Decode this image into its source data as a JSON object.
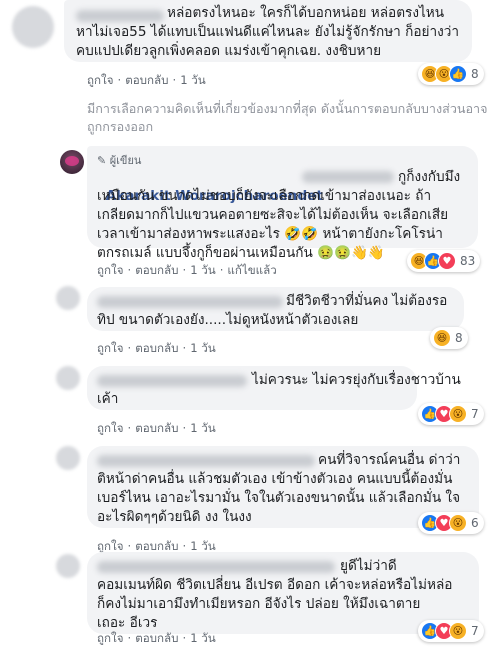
{
  "comments": [
    {
      "lines": [
        "หล่อตรงไหนอะ ใครก็ได้บอกหน่อย หล่อตรงไหน",
        "หาไม่เจอ55 ได้แทบเป็นแฟนดีแค่ไหนละ ยังไม่รู้จักรักษา ก็อย่างว่า",
        "คบแปปเดียวลูกเพิ่งคลอด แมร่งเข้าคุกเฉย. งงชิบหาย"
      ],
      "actions": {
        "like": "ถูกใจ",
        "reply": "ตอบกลับ",
        "time": "1 วัน"
      },
      "reactions": {
        "count": "8"
      }
    },
    {
      "author_tag": "ผู้เขียน",
      "author": "Akarakit Worarojcharoendet",
      "lines": [
        "กูก็งงกับมึง",
        "เหมือนกัน ขนาดไม่ชอบก็ยังจะเลือกกดเข้ามาส่องเนอะ ถ้า",
        "เกลียดมากก็ไปแขวนคอตายซะสิจะได้ไม่ต้องเห็น จะเลือกเสีย",
        "เวลาเข้ามาส่องหาพระแสงอะไร 🤣🤣 หน้าตายังกะโคโรน่า",
        "ตกรถเมล์ แบบจึ้งกูก็ขอผ่านเหมือนกัน 🤢🤢👋👋"
      ],
      "actions": {
        "like": "ถูกใจ",
        "reply": "ตอบกลับ",
        "time": "1 วัน",
        "edited": "แก้ไขแล้ว"
      },
      "reactions": {
        "count": "83"
      }
    },
    {
      "lines": [
        "มีชีวิตชีวาที่มั่นคง ไม่ต้องรอ",
        "ทิป ขนาดตัวเองยัง.....ไม่ดูหนังหน้าตัวเองเลย"
      ],
      "actions": {
        "like": "ถูกใจ",
        "reply": "ตอบกลับ",
        "time": "1 วัน"
      },
      "reactions": {
        "count": "8"
      }
    },
    {
      "lines": [
        "ไม่ควรนะ ไม่ควรยุ่งกับเรื่องชาวบ้าน",
        "เค้า"
      ],
      "actions": {
        "like": "ถูกใจ",
        "reply": "ตอบกลับ",
        "time": "1 วัน"
      },
      "reactions": {
        "count": "7"
      }
    },
    {
      "lines": [
        "คนที่วิจารณ์คนอื่น ด่าว่า",
        "ติหน้าด่าคนอื่น แล้วชมตัวเอง เข้าข้างตัวเอง คนแบบนี้ต้องมั่น",
        "เบอร์ไหน เอาอะไรมามั่น ใจในตัวเองขนาดนั้น แล้วเลือกมั่น ใจ",
        "อะไรผิดๆๆด้วยนิดิ งง ในงง"
      ],
      "actions": {
        "like": "ถูกใจ",
        "reply": "ตอบกลับ",
        "time": "1 วัน"
      },
      "reactions": {
        "count": "6"
      }
    },
    {
      "lines": [
        "ยูดีไม่ว่าดี",
        "คอมเมนท์ผิด ชีวิตเปลี่ยน อีเปรต อีดอก เค้าจะหล่อหรือไม่หล่อ",
        "ก็คงไม่มาเอามึงทำเมียหรอก อีจังไร ปล่อย ให้มึงเฉาตาย",
        "เถอะ อีเวร"
      ],
      "actions": {
        "like": "ถูกใจ",
        "reply": "ตอบกลับ",
        "time": "1 วัน"
      },
      "reactions": {
        "count": "7"
      }
    }
  ],
  "notice": "มีการเลือกความคิดเห็นที่เกี่ยวข้องมากที่สุด ดังนั้นการตอบกลับบางส่วนอาจถูกกรองออก",
  "colors": {
    "bubble": "#f2f3f5",
    "link": "#385898",
    "meta": "#606770",
    "like_blue": "#1877f2",
    "love_red": "#f33e58",
    "haha_yellow": "#f7b125"
  },
  "icons": [
    "like-icon",
    "love-icon",
    "haha-icon",
    "wow-icon",
    "pencil-icon"
  ]
}
